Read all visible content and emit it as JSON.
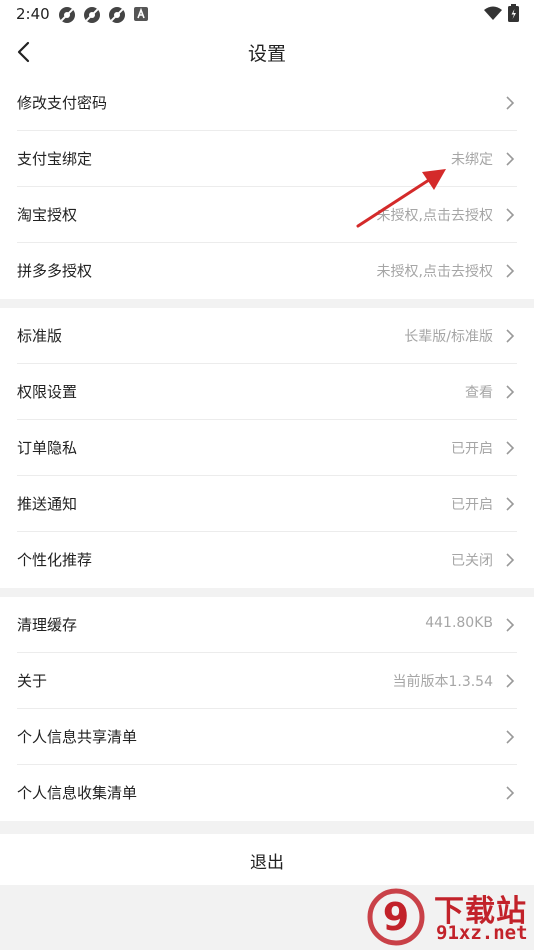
{
  "status_bar": {
    "time": "2:40",
    "icons_left": [
      "app-notification-icon",
      "app-notification-icon",
      "app-notification-icon",
      "a-badge-icon"
    ],
    "icons_right": [
      "wifi-icon",
      "battery-icon"
    ]
  },
  "header": {
    "title": "设置",
    "back_icon": "chevron-left-icon"
  },
  "groups": [
    {
      "rows": [
        {
          "label": "修改支付密码",
          "value": ""
        },
        {
          "label": "支付宝绑定",
          "value": "未绑定"
        },
        {
          "label": "淘宝授权",
          "value": "未授权,点击去授权"
        },
        {
          "label": "拼多多授权",
          "value": "未授权,点击去授权"
        }
      ]
    },
    {
      "rows": [
        {
          "label": "标准版",
          "value": "长辈版/标准版"
        },
        {
          "label": "权限设置",
          "value": "查看"
        },
        {
          "label": "订单隐私",
          "value": "已开启"
        },
        {
          "label": "推送通知",
          "value": "已开启"
        },
        {
          "label": "个性化推荐",
          "value": "已关闭"
        }
      ]
    },
    {
      "rows": [
        {
          "label": "清理缓存",
          "value": "441.80KB"
        },
        {
          "label": "关于",
          "value": "当前版本1.3.54"
        },
        {
          "label": "个人信息共享清单",
          "value": ""
        },
        {
          "label": "个人信息收集清单",
          "value": ""
        }
      ]
    }
  ],
  "logout_label": "退出",
  "watermark": {
    "text": "下载站",
    "domain": "91xz.net",
    "logo_glyph": "9"
  },
  "colors": {
    "annotation_arrow": "#d42a2a",
    "watermark": "#c2222a",
    "value_text": "#a6a6a6"
  }
}
